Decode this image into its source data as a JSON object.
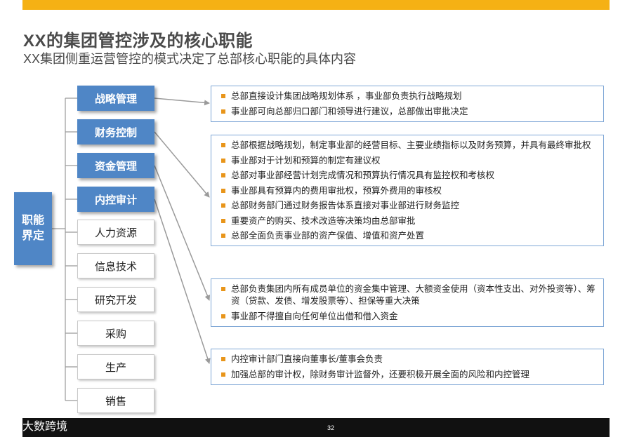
{
  "header": {
    "title": "XX的集团管控涉及的核心职能",
    "subtitle": "XX集团侧重运营管控的模式决定了总部核心职能的具体内容"
  },
  "root": {
    "label": "职能界定"
  },
  "functions": [
    {
      "label": "战略管理",
      "highlighted": true
    },
    {
      "label": "财务控制",
      "highlighted": true
    },
    {
      "label": "资金管理",
      "highlighted": true
    },
    {
      "label": "内控审计",
      "highlighted": true
    },
    {
      "label": "人力资源",
      "highlighted": false
    },
    {
      "label": "信息技术",
      "highlighted": false
    },
    {
      "label": "研究开发",
      "highlighted": false
    },
    {
      "label": "采购",
      "highlighted": false
    },
    {
      "label": "生产",
      "highlighted": false
    },
    {
      "label": "销售",
      "highlighted": false
    }
  ],
  "details": [
    {
      "items": [
        "总部直接设计集团战略规划体系 ，事业部负责执行战略规划",
        "事业部可向总部归口部门和领导进行建议，总部做出审批决定"
      ]
    },
    {
      "items": [
        "总部根据战略规划，制定事业部的经营目标、主要业绩指标以及财务预算，并具有最终审批权",
        "事业部对于计划和预算的制定有建议权",
        "总部对事业部经营计划完成情况和预算执行情况具有监控权和考核权",
        "事业部具有预算内的费用审批权，预算外费用的审核权",
        "总部财务部门通过财务报告体系直接对事业部进行财务监控",
        "重要资产的购买、技术改造等决策均由总部审批",
        "总部全面负责事业部的资产保值、增值和资产处置"
      ]
    },
    {
      "items": [
        "总部负责集团内所有成员单位的资金集中管理、大额资金使用（资本性支出、对外投资等）、筹资（贷款、发债、增发股票等）、担保等重大决策",
        "事业部不得擅自向任何单位出借和借入资金"
      ]
    },
    {
      "items": [
        "内控审计部门直接向董事长/董事会负责",
        "加强总部的审计权，除财务审计监督外，还要积极开展全面的风险和内控管理"
      ]
    }
  ],
  "footer": {
    "page_number": "32",
    "watermark": "大数跨境"
  },
  "colors": {
    "accent_bar": "#f5b114",
    "primary_box": "#4f86c6",
    "bullet": "#e8951a",
    "detail_border": "#7fa7d6",
    "footer_bar": "#111111"
  }
}
